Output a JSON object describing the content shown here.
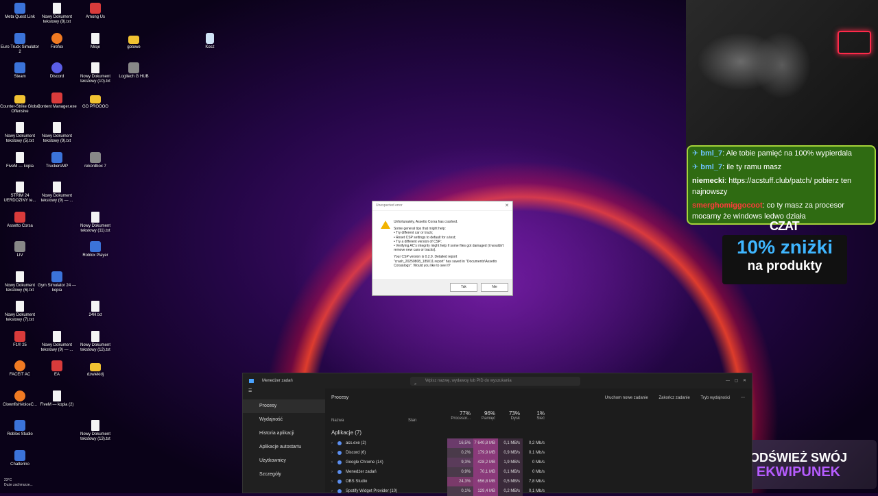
{
  "desktop_icons": [
    {
      "label": "Meta Quest Link",
      "kind": "app"
    },
    {
      "label": "Nowy Dokument tekstowy (8).txt",
      "kind": "txt"
    },
    {
      "label": "Among Us",
      "kind": "red"
    },
    {
      "label": "Euro Truck Simulator 2",
      "kind": "app"
    },
    {
      "label": "Firefox",
      "kind": "orange"
    },
    {
      "label": "Misje",
      "kind": "txt"
    },
    {
      "label": "gotowe",
      "kind": "folder"
    },
    {
      "label": "Kosz",
      "kind": "bin"
    },
    {
      "label": "Steam",
      "kind": "app"
    },
    {
      "label": "Discord",
      "kind": "purple"
    },
    {
      "label": "Nowy Dokument tekstowy (10).txt",
      "kind": "txt"
    },
    {
      "label": "Logitech G HUB",
      "kind": "gray"
    },
    {
      "label": "Counter-Strike Global Offensive",
      "kind": "folder"
    },
    {
      "label": "Content Manager.exe",
      "kind": "red"
    },
    {
      "label": "GO PROOOO",
      "kind": "folder"
    },
    {
      "label": "Nowy Dokument tekstowy (5).txt",
      "kind": "txt"
    },
    {
      "label": "Nowy Dokument tekstowy (9).txt",
      "kind": "txt"
    },
    {
      "label": "FiveM — kopia",
      "kind": "txt"
    },
    {
      "label": "TruckersMP",
      "kind": "app"
    },
    {
      "label": "rekordbox 7",
      "kind": "gray"
    },
    {
      "label": "STRIM 24 UERDOZINY te...",
      "kind": "txt"
    },
    {
      "label": "Nowy Dokument tekstowy (9) — ...",
      "kind": "txt"
    },
    {
      "label": "Assetto Corsa",
      "kind": "red"
    },
    {
      "label": "Nowy Dokument tekstowy (11).txt",
      "kind": "txt"
    },
    {
      "label": "LIV",
      "kind": "gray"
    },
    {
      "label": "Roblox Player",
      "kind": "app"
    },
    {
      "label": "Nowy Dokument tekstowy (6).txt",
      "kind": "txt"
    },
    {
      "label": "Gym Simulator 24 — kopia",
      "kind": "app"
    },
    {
      "label": "Nowy Dokument tekstowy (7).txt",
      "kind": "txt"
    },
    {
      "label": "24H.txt",
      "kind": "txt"
    },
    {
      "label": "F1® 25",
      "kind": "red"
    },
    {
      "label": "Nowy Dokument tekstowy (9) — ...",
      "kind": "txt"
    },
    {
      "label": "Nowy Dokument tekstowy (12).txt",
      "kind": "txt"
    },
    {
      "label": "FACEIT AC",
      "kind": "orange"
    },
    {
      "label": "EA",
      "kind": "red"
    },
    {
      "label": "dzwiekidj",
      "kind": "folder"
    },
    {
      "label": "ClownfishVoiceC...",
      "kind": "orange"
    },
    {
      "label": "FiveM — kopia (2)",
      "kind": "txt"
    },
    {
      "label": "Roblox Studio",
      "kind": "app"
    },
    {
      "label": "Nowy Dokument tekstowy (13).txt",
      "kind": "txt"
    },
    {
      "label": "Chatterino",
      "kind": "app"
    }
  ],
  "chat": {
    "messages": [
      {
        "user": "bml_7",
        "text": "Ale tobie pamięć na 100% wypierdala",
        "user_color": "#6fc3ff"
      },
      {
        "user": "bml_7",
        "text": "ile ty ramu masz",
        "user_color": "#6fc3ff"
      },
      {
        "user": "niemecki",
        "text": "https://acstuff.club/patch/ pobierz ten najnowszy",
        "user_color": "#ffffff"
      },
      {
        "user": "smerghomiggocoot",
        "text": "co ty masz za procesor mocarny że windows ledwo działa",
        "user_color": "#ff3b3b"
      }
    ],
    "title": "CZAT"
  },
  "promo": {
    "line1": "10% zniżki",
    "line2": "na produkty"
  },
  "equip_banner": {
    "line1": "ODŚWIEŻ SWÓJ",
    "line2": "EKWIPUNEK"
  },
  "dialog": {
    "title": "Unexpected error",
    "lines": [
      "Unfortunately, Assetto Corsa has crashed.",
      "",
      "Some general tips that might help:",
      "• Try different car or track;",
      "• Reset CSP settings to default for a test;",
      "• Try a different version of CSP;",
      "• Verifying AC's integrity might help if some files got damaged (it wouldn't remove new cars or tracks).",
      "",
      "Your CSP version is 0.2.9. Detailed report \"crash_20250808_185011.report\" has saved in \"Documents\\Assetto Corsa\\logs\". Would you like to see it?"
    ],
    "yes": "Tak",
    "no": "Nie"
  },
  "task_manager": {
    "title": "Menedżer zadań",
    "search_placeholder": "Wpisz nazwę, wydawcę lub PID do wyszukania",
    "nav": [
      "Procesy",
      "Wydajność",
      "Historia aplikacji",
      "Aplikacje autostartu",
      "Użytkownicy",
      "Szczegóły"
    ],
    "header": "Procesy",
    "actions": [
      "Uruchom nowe zadanie",
      "Zakończ zadanie",
      "Tryb wydajności"
    ],
    "columns": {
      "name": "Nazwa",
      "status": "Stan",
      "cpu_pct": "77%",
      "cpu": "Procesor...",
      "mem_pct": "96%",
      "mem": "Pamięć",
      "disk_pct": "73%",
      "disk": "Dysk",
      "net_pct": "1%",
      "net": "Sieć"
    },
    "section": "Aplikacje (7)",
    "rows": [
      {
        "name": "acs.exe (2)",
        "cpu": "16,5%",
        "mem": "7 640,8 MB",
        "disk": "0,1 MB/s",
        "net": "0,2 Mb/s"
      },
      {
        "name": "Discord (6)",
        "cpu": "0,2%",
        "mem": "179,9 MB",
        "disk": "0,9 MB/s",
        "net": "0,1 Mb/s"
      },
      {
        "name": "Google Chrome (14)",
        "cpu": "9,3%",
        "mem": "428,2 MB",
        "disk": "1,9 MB/s",
        "net": "0 Mb/s"
      },
      {
        "name": "Menedżer zadań",
        "cpu": "0,9%",
        "mem": "70,1 MB",
        "disk": "0,1 MB/s",
        "net": "0 Mb/s"
      },
      {
        "name": "OBS Studio",
        "cpu": "24,3%",
        "mem": "656,8 MB",
        "disk": "0,5 MB/s",
        "net": "7,8 Mb/s"
      },
      {
        "name": "Spotify Widget Provider (10)",
        "cpu": "0,1%",
        "mem": "129,4 MB",
        "disk": "0,2 MB/s",
        "net": "0,1 Mb/s"
      }
    ]
  },
  "weather": {
    "temp": "23°C",
    "desc": "Duże zachmurze..."
  }
}
